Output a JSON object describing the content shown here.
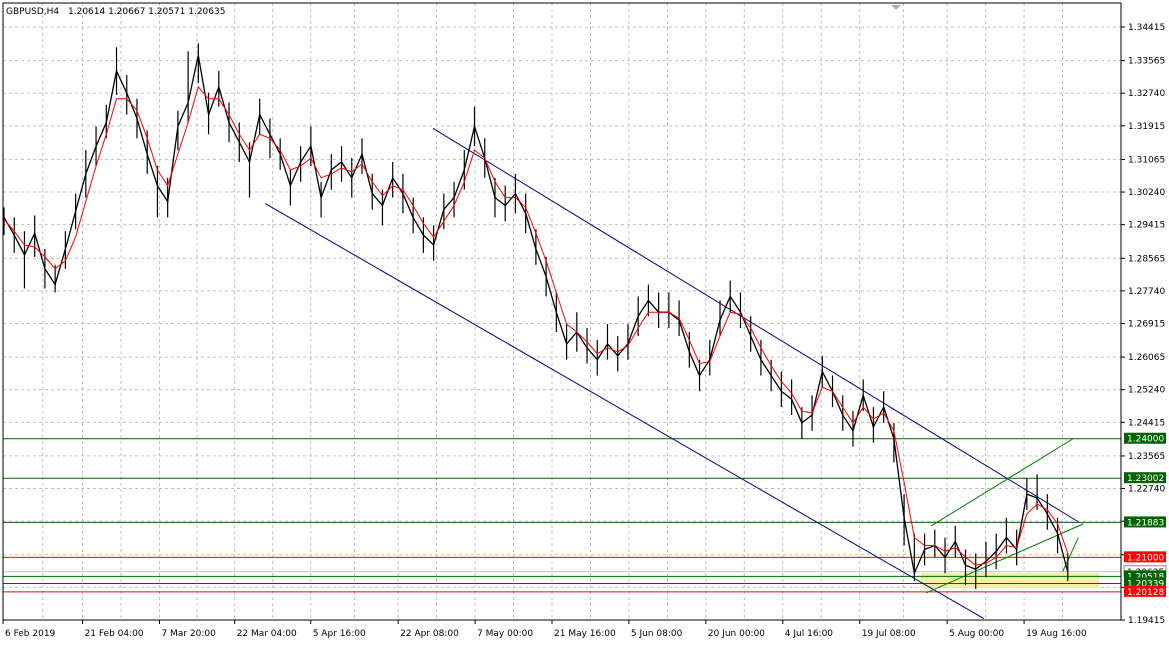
{
  "header": {
    "symbol": "GBPUSD,H4",
    "ohlc": "1.20614 1.20667 1.20571 1.20635"
  },
  "colors": {
    "background": "#ffffff",
    "frame": "#000000",
    "grid": "#c0c0c0",
    "candles": "#000000",
    "moving_average": "#ff0000",
    "down_channel": "#00007f",
    "up_channel": "#007f00",
    "resistance": "#006400",
    "support": "#ff0000",
    "zone": "#f0f0a0",
    "scroll_marker": "#b0b0b0"
  },
  "chart_data": {
    "type": "line",
    "title": "GBPUSD,H4",
    "xlabel": "",
    "ylabel": "",
    "grid": true,
    "ylim": [
      1.19415,
      1.34415
    ],
    "x": [
      "2019-02-06 00:00",
      "2019-02-21 04:00",
      "2019-03-07 20:00",
      "2019-03-22 04:00",
      "2019-04-05 16:00",
      "2019-04-22 08:00",
      "2019-05-07 00:00",
      "2019-05-21 16:00",
      "2019-06-05 08:00",
      "2019-06-20 00:00",
      "2019-07-04 16:00",
      "2019-07-19 08:00",
      "2019-08-05 00:00",
      "2019-08-19 16:00",
      "2019-09-03 08:00"
    ],
    "tick_labels": [
      "6 Feb 2019",
      "21 Feb 04:00",
      "7 Mar 20:00",
      "22 Mar 04:00",
      "5 Apr 16:00",
      "22 Apr 08:00",
      "7 May 00:00",
      "21 May 16:00",
      "5 Jun 08:00",
      "20 Jun 00:00",
      "4 Jul 16:00",
      "19 Jul 08:00",
      "5 Aug 00:00",
      "19 Aug 16:00"
    ],
    "y_ticks": [
      "1.34415",
      "1.33565",
      "1.32740",
      "1.31915",
      "1.31065",
      "1.30240",
      "1.29415",
      "1.28565",
      "1.27740",
      "1.26915",
      "1.26065",
      "1.25240",
      "1.24415",
      "1.23565",
      "1.22740",
      "1.21915",
      "1.21065",
      "1.20240",
      "1.19415"
    ],
    "series": [
      {
        "values": [
          1.296,
          1.2915,
          1.2865,
          1.292,
          1.283,
          1.279,
          1.288,
          1.2975,
          1.307,
          1.314,
          1.32,
          1.333,
          1.3275,
          1.321,
          1.312,
          1.304,
          1.3,
          1.319,
          1.325,
          1.337,
          1.322,
          1.329,
          1.32,
          1.315,
          1.31,
          1.322,
          1.317,
          1.312,
          1.304,
          1.31,
          1.314,
          1.301,
          1.308,
          1.31,
          1.306,
          1.312,
          1.302,
          1.299,
          1.306,
          1.302,
          1.296,
          1.2915,
          1.289,
          1.298,
          1.301,
          1.308,
          1.319,
          1.311,
          1.301,
          1.299,
          1.302,
          1.297,
          1.288,
          1.281,
          1.272,
          1.264,
          1.267,
          1.263,
          1.26,
          1.264,
          1.261,
          1.264,
          1.271,
          1.275,
          1.272,
          1.272,
          1.27,
          1.262,
          1.256,
          1.26,
          1.27,
          1.276,
          1.272,
          1.266,
          1.26,
          1.256,
          1.252,
          1.25,
          1.244,
          1.246,
          1.257,
          1.252,
          1.246,
          1.242,
          1.251,
          1.243,
          1.248,
          1.24,
          1.22,
          1.206,
          1.212,
          1.213,
          1.21,
          1.214,
          1.208,
          1.207,
          1.209,
          1.2115,
          1.215,
          1.212,
          1.226,
          1.225,
          1.221,
          1.216,
          1.2063
        ],
        "lows": [
          1.2915,
          1.287,
          1.278,
          1.286,
          1.278,
          1.277,
          1.283,
          1.293,
          1.301,
          1.309,
          1.316,
          1.327,
          1.322,
          1.316,
          1.307,
          1.296,
          1.296,
          1.313,
          1.32,
          1.33,
          1.317,
          1.324,
          1.315,
          1.31,
          1.301,
          1.317,
          1.311,
          1.308,
          1.299,
          1.305,
          1.309,
          1.296,
          1.303,
          1.305,
          1.301,
          1.307,
          1.298,
          1.294,
          1.301,
          1.297,
          1.292,
          1.287,
          1.285,
          1.293,
          1.296,
          1.303,
          1.314,
          1.306,
          1.296,
          1.295,
          1.297,
          1.292,
          1.284,
          1.276,
          1.267,
          1.26,
          1.262,
          1.259,
          1.256,
          1.26,
          1.257,
          1.26,
          1.266,
          1.271,
          1.268,
          1.268,
          1.266,
          1.258,
          1.252,
          1.256,
          1.266,
          1.272,
          1.268,
          1.262,
          1.256,
          1.252,
          1.248,
          1.246,
          1.24,
          1.242,
          1.253,
          1.248,
          1.242,
          1.238,
          1.247,
          1.239,
          1.244,
          1.234,
          1.213,
          1.204,
          1.208,
          1.21,
          1.206,
          1.21,
          1.203,
          1.202,
          1.205,
          1.207,
          1.211,
          1.208,
          1.222,
          1.222,
          1.217,
          1.211,
          1.204
        ],
        "highs": [
          1.2985,
          1.296,
          1.2925,
          1.2965,
          1.288,
          1.284,
          1.2925,
          1.302,
          1.313,
          1.319,
          1.3245,
          1.339,
          1.332,
          1.326,
          1.318,
          1.309,
          1.306,
          1.323,
          1.338,
          1.34,
          1.3275,
          1.333,
          1.325,
          1.32,
          1.315,
          1.326,
          1.321,
          1.316,
          1.308,
          1.314,
          1.319,
          1.305,
          1.312,
          1.314,
          1.311,
          1.316,
          1.307,
          1.303,
          1.31,
          1.307,
          1.301,
          1.296,
          1.294,
          1.302,
          1.305,
          1.313,
          1.324,
          1.316,
          1.306,
          1.304,
          1.307,
          1.302,
          1.293,
          1.286,
          1.277,
          1.269,
          1.272,
          1.268,
          1.265,
          1.269,
          1.266,
          1.269,
          1.276,
          1.279,
          1.277,
          1.277,
          1.275,
          1.267,
          1.26,
          1.265,
          1.275,
          1.28,
          1.277,
          1.271,
          1.265,
          1.26,
          1.257,
          1.255,
          1.248,
          1.251,
          1.261,
          1.256,
          1.251,
          1.247,
          1.255,
          1.248,
          1.252,
          1.244,
          1.226,
          1.216,
          1.216,
          1.217,
          1.215,
          1.218,
          1.212,
          1.211,
          1.214,
          1.216,
          1.22,
          1.217,
          1.23,
          1.231,
          1.226,
          1.22,
          1.211
        ]
      }
    ],
    "moving_average": [
      1.2955,
      1.2925,
      1.289,
      1.2885,
      1.286,
      1.283,
      1.285,
      1.291,
      1.3,
      1.309,
      1.317,
      1.326,
      1.326,
      1.323,
      1.316,
      1.308,
      1.304,
      1.312,
      1.32,
      1.329,
      1.326,
      1.326,
      1.322,
      1.317,
      1.313,
      1.317,
      1.316,
      1.313,
      1.308,
      1.309,
      1.311,
      1.306,
      1.307,
      1.3085,
      1.3075,
      1.3095,
      1.305,
      1.3015,
      1.304,
      1.303,
      1.299,
      1.2945,
      1.291,
      1.295,
      1.299,
      1.305,
      1.313,
      1.311,
      1.305,
      1.301,
      1.301,
      1.2985,
      1.292,
      1.285,
      1.277,
      1.269,
      1.267,
      1.2645,
      1.2615,
      1.263,
      1.262,
      1.2635,
      1.268,
      1.272,
      1.272,
      1.272,
      1.2705,
      1.265,
      1.259,
      1.2595,
      1.266,
      1.272,
      1.2715,
      1.268,
      1.263,
      1.2585,
      1.2545,
      1.2515,
      1.247,
      1.2465,
      1.253,
      1.252,
      1.248,
      1.244,
      1.248,
      1.245,
      1.2465,
      1.242,
      1.229,
      1.215,
      1.213,
      1.213,
      1.2115,
      1.2125,
      1.21,
      1.208,
      1.2085,
      1.21,
      1.213,
      1.2125,
      1.221,
      1.2235,
      1.222,
      1.2185,
      1.211
    ],
    "levels": [
      {
        "value": 1.24,
        "label": "1.24000",
        "kind": "resistance"
      },
      {
        "value": 1.23002,
        "label": "1.23002",
        "kind": "resistance"
      },
      {
        "value": 1.21883,
        "label": "1.21883",
        "kind": "resistance"
      },
      {
        "value": 1.21,
        "label": "1.21000",
        "kind": "support"
      },
      {
        "value": 1.20635,
        "label": "1.20635",
        "kind": "current"
      },
      {
        "value": 1.20518,
        "label": "1.20518",
        "kind": "resistance"
      },
      {
        "value": 1.20339,
        "label": "1.20339",
        "kind": "resistance"
      },
      {
        "value": 1.20128,
        "label": "1.20128",
        "kind": "support"
      }
    ],
    "down_channel": {
      "upper": {
        "from": [
          "2019-04-29 00:00",
          1.3185
        ],
        "to": [
          "2019-08-30 00:00",
          1.219
        ]
      },
      "lower": {
        "from": [
          "2019-03-28 00:00",
          1.2995
        ],
        "to": [
          "2019-08-12 00:00",
          1.1945
        ]
      }
    },
    "up_channel": {
      "upper": {
        "from": [
          "2019-08-02 00:00",
          1.218
        ],
        "to": [
          "2019-08-29 00:00",
          1.24
        ]
      },
      "lower": {
        "from": [
          "2019-08-01 00:00",
          1.201
        ],
        "to": [
          "2019-08-31 00:00",
          1.2185
        ]
      }
    },
    "projection": {
      "from": [
        "2019-08-27 00:00",
        1.2063
      ],
      "to": [
        "2019-08-30 00:00",
        1.215
      ]
    },
    "zone": {
      "x_from": "2019-07-31 00:00",
      "x_to": "2019-09-03 00:00",
      "y_from": 1.2033,
      "y_to": 1.205
    }
  }
}
